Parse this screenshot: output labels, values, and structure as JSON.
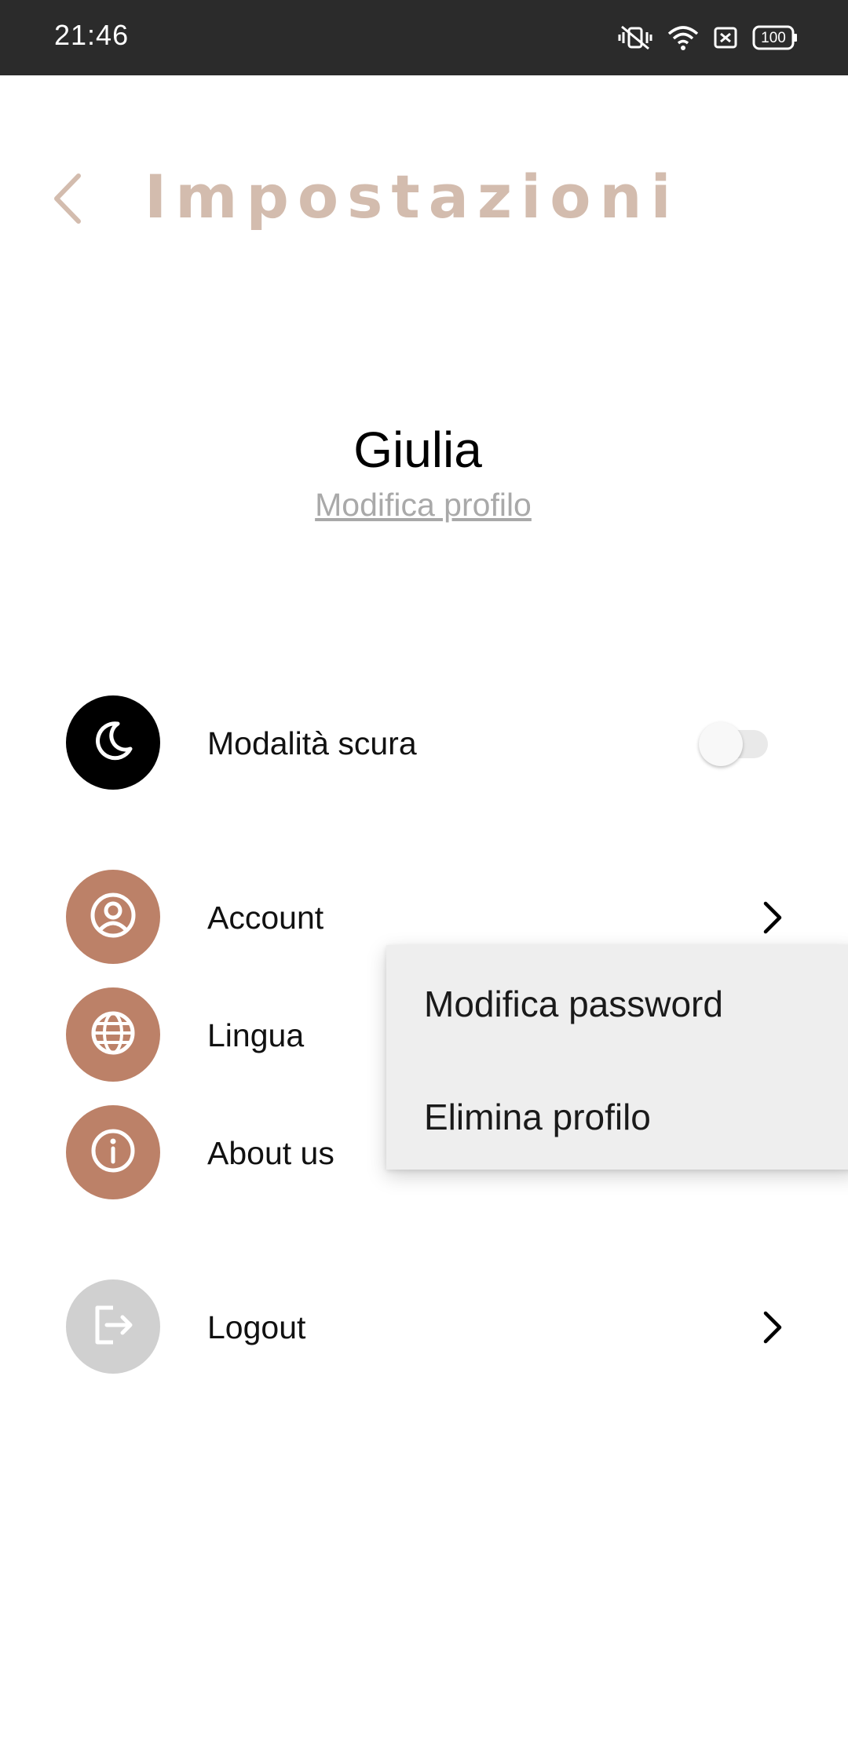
{
  "status_bar": {
    "time": "21:46",
    "battery": "100",
    "icons": [
      "vibrate-off-icon",
      "wifi-icon",
      "no-sim-icon",
      "battery-icon"
    ]
  },
  "header": {
    "title": "Impostazioni",
    "back_icon": "chevron-left-icon"
  },
  "profile": {
    "name": "Giulia",
    "edit_link": "Modifica profilo"
  },
  "settings": {
    "dark_mode": {
      "label": "Modalità scura",
      "icon": "moon-icon",
      "enabled": false
    },
    "account": {
      "label": "Account",
      "icon": "user-circle-icon"
    },
    "language": {
      "label": "Lingua",
      "icon": "globe-icon"
    },
    "about": {
      "label": "About us",
      "icon": "info-icon"
    },
    "logout": {
      "label": "Logout",
      "icon": "logout-icon"
    }
  },
  "popup_menu": {
    "items": [
      "Modifica password",
      "Elimina profilo"
    ]
  },
  "colors": {
    "accent": "#bc8168",
    "title": "#d3bcae",
    "dark_circle": "#000000",
    "logout_circle": "#d0d0d0",
    "status_bar": "#2b2b2b"
  }
}
